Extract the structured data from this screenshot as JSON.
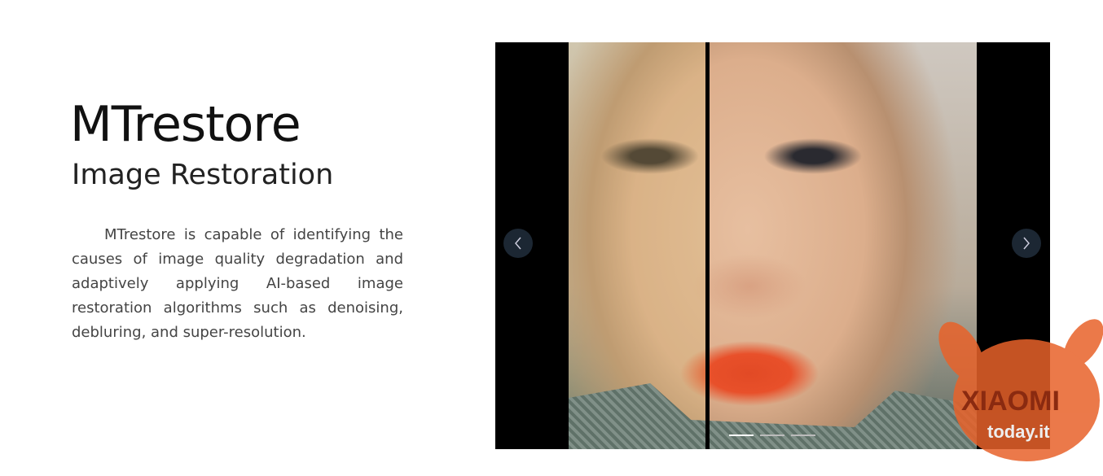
{
  "hero": {
    "title": "MTrestore",
    "subtitle": "Image Restoration",
    "description": "MTrestore is capable of identifying the causes of image quality degradation and adaptively applying AI-based image restoration algorithms such as denoising, debluring, and super-resolution."
  },
  "carousel": {
    "prev_icon": "chevron-left-icon",
    "next_icon": "chevron-right-icon",
    "slides": 3,
    "active_slide": 1
  },
  "watermark": {
    "line1": "XIAOMI",
    "line2": "today.it",
    "color": "#e8622a"
  }
}
